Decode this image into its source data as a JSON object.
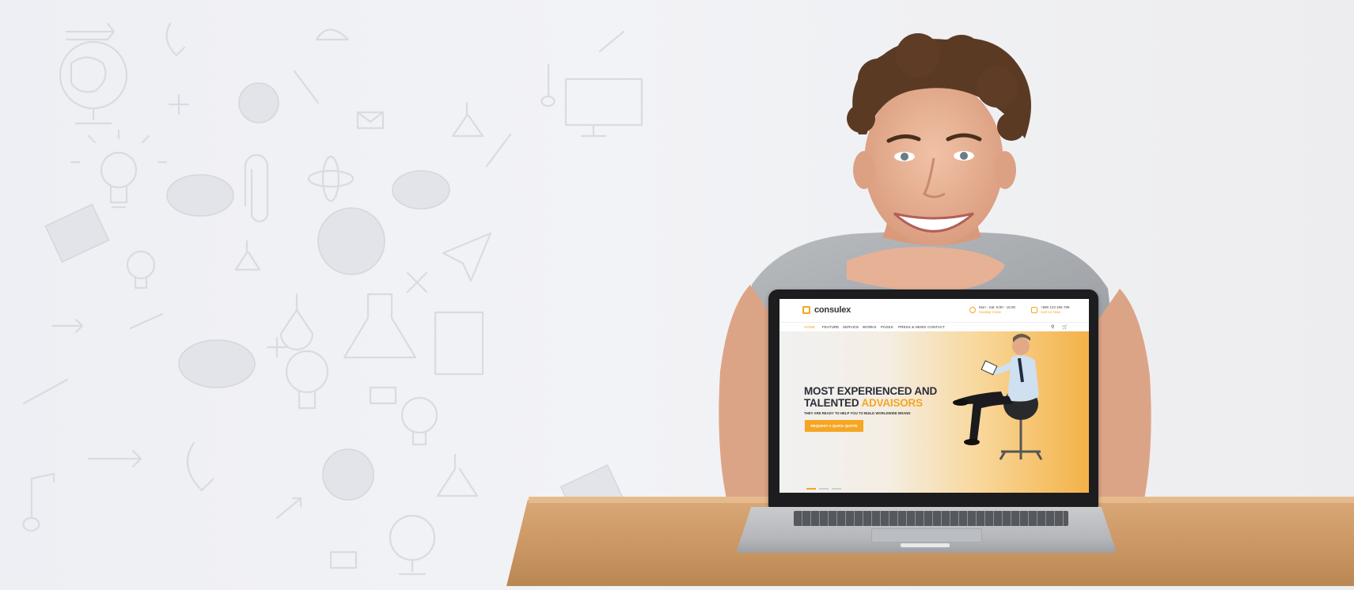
{
  "site": {
    "logo": "consulex",
    "hours_label": "Mon - Sat: 8:00 - 16:00",
    "hours_sub": "Sunday Close",
    "phone_label": "+880 123 456 789",
    "phone_sub": "Call Us Now",
    "nav": [
      "HOME",
      "FEATURE",
      "SERVICE",
      "WORKS",
      "PAGES",
      "PRESS & NEWS",
      "CONTACT"
    ],
    "hero_title_line1": "MOST EXPERIENCED AND",
    "hero_title_line2_a": "TALENTED ",
    "hero_title_line2_b": "ADVAISORS",
    "hero_subtitle": "THEY ARE READY TO HELP YOU TO BUILD WORLDWIDE BRAND",
    "hero_button": "REQUEST A QUICK QUOTE",
    "slider_active_index": 0,
    "slider_count": 3
  },
  "colors": {
    "accent": "#f5a623",
    "heading": "#2b2e3a"
  },
  "icons": [
    "clock-icon",
    "phone-icon",
    "search-icon",
    "cart-icon"
  ]
}
